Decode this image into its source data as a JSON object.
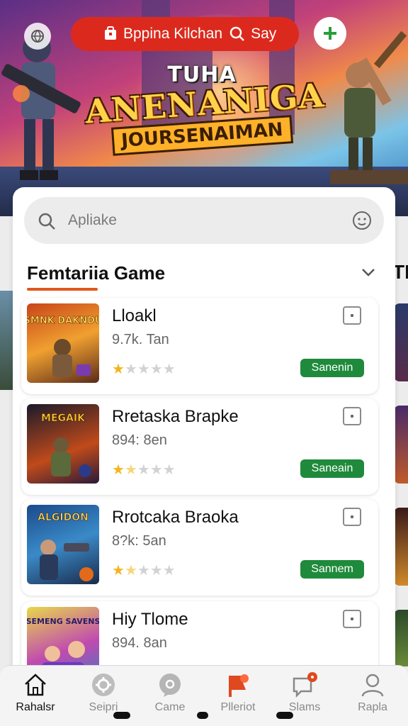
{
  "header": {
    "search_pill_text_left": "Bppina Kilchan",
    "search_pill_text_right": "Say",
    "search_pill_color": "#db2a1d"
  },
  "banner": {
    "line1": "TUHA",
    "line2": "ANENANIGA",
    "line3": "JOURSENAIMAN"
  },
  "search": {
    "placeholder": "Apliake"
  },
  "section": {
    "title": "Femtariia Game",
    "accent": "#e2561b"
  },
  "side_peek_text": "TI",
  "games": [
    {
      "name": "Lloakl",
      "meta": "9.7k. Tan",
      "rating": 1,
      "action": "Sanenin",
      "thumb_title": "SMNK DAKNDU"
    },
    {
      "name": "Rretaska Brapke",
      "meta": "894: 8en",
      "rating": 1.5,
      "action": "Saneain",
      "thumb_title": "MEGAIK"
    },
    {
      "name": "Rrotcaka Braoka",
      "meta": "8?k: 5an",
      "rating": 1.5,
      "action": "Sannem",
      "thumb_title": "ALGIDON"
    },
    {
      "name": "Hiy Tlome",
      "meta": "894. 8an",
      "rating": 0,
      "action": "",
      "thumb_title": "SEMENG SAVENS"
    }
  ],
  "action_color": "#1f8a3b",
  "bottom_nav": [
    {
      "label": "Rahalsr",
      "icon": "home-icon",
      "active": true
    },
    {
      "label": "Seipri",
      "icon": "gear-badge-icon",
      "active": false
    },
    {
      "label": "Came",
      "icon": "chat-bubble-icon",
      "active": false
    },
    {
      "label": "Plleriot",
      "icon": "flag-icon",
      "active": false
    },
    {
      "label": "Slams",
      "icon": "chat-notification-icon",
      "active": false
    },
    {
      "label": "Rapla",
      "icon": "profile-icon",
      "active": false
    }
  ]
}
